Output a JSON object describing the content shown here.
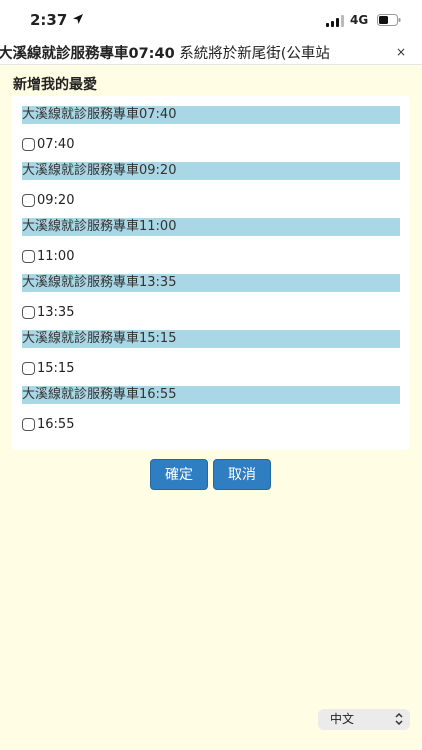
{
  "status_bar": {
    "time": "2:37",
    "network": "4G",
    "icons": [
      "location-arrow-icon",
      "signal-icon",
      "battery-icon"
    ]
  },
  "banner": {
    "marquee_bold": "大溪線就診服務專車07:40",
    "marquee_text": " 系統將於新尾街(公車站",
    "close_label": "×"
  },
  "dialog": {
    "title": "新增我的最愛",
    "routes": [
      {
        "name": "大溪線就診服務專車07:40",
        "time": "07:40"
      },
      {
        "name": "大溪線就診服務專車09:20",
        "time": "09:20"
      },
      {
        "name": "大溪線就診服務專車11:00",
        "time": "11:00"
      },
      {
        "name": "大溪線就診服務專車13:35",
        "time": "13:35"
      },
      {
        "name": "大溪線就診服務專車15:15",
        "time": "15:15"
      },
      {
        "name": "大溪線就診服務專車16:55",
        "time": "16:55"
      }
    ],
    "confirm_label": "確定",
    "cancel_label": "取消"
  },
  "language": {
    "selected": "中文"
  },
  "colors": {
    "page_background": "#fffde3",
    "route_header": "#a9d7e5",
    "button": "#2f7ec1"
  }
}
